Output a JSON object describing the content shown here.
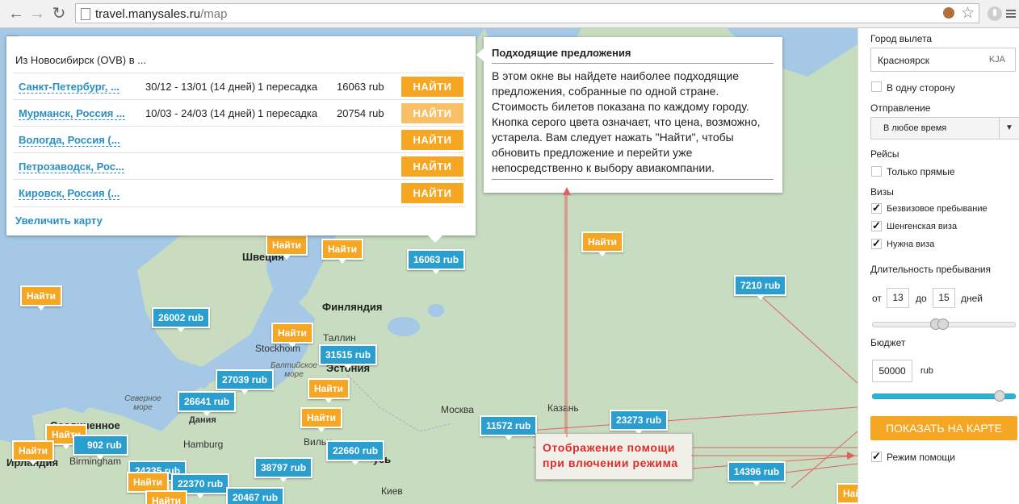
{
  "browser": {
    "url_host": "travel.manysales.ru",
    "url_path": "/map"
  },
  "map": {
    "labels": {
      "sweden": "Швеция",
      "finland": "Финляндия",
      "tallinn": "Таллин",
      "stockholm": "Stockholm",
      "baltic_sea": "Балтийское море",
      "estonia": "Эстония",
      "north_sea": "Северное море",
      "denmark": "Дания",
      "hamburg": "Hamburg",
      "birmingham": "Birmingham",
      "ireland": "Ирландия",
      "uk": "Соединенное",
      "moscow": "Москва",
      "kazan": "Казань",
      "vilnius": "Вильн",
      "kiev": "Киев",
      "russia_frag": "усь"
    },
    "pins": [
      {
        "text": "16063 rub",
        "kind": "price"
      },
      {
        "text": "Найти",
        "kind": "find"
      },
      {
        "text": "Найти",
        "kind": "find"
      },
      {
        "text": "Найти",
        "kind": "find"
      },
      {
        "text": "7210 rub",
        "kind": "price"
      },
      {
        "text": "Найти",
        "kind": "find"
      },
      {
        "text": "26002 rub",
        "kind": "price"
      },
      {
        "text": "Найти",
        "kind": "find"
      },
      {
        "text": "31515 rub",
        "kind": "price"
      },
      {
        "text": "27039 rub",
        "kind": "price"
      },
      {
        "text": "26641 rub",
        "kind": "price"
      },
      {
        "text": "Найти",
        "kind": "find"
      },
      {
        "text": "Найти",
        "kind": "find"
      },
      {
        "text": "11572 rub",
        "kind": "price"
      },
      {
        "text": "23273 rub",
        "kind": "price"
      },
      {
        "text": "22660 rub",
        "kind": "price"
      },
      {
        "text": "38797 rub",
        "kind": "price"
      },
      {
        "text": "24235 rub",
        "kind": "price"
      },
      {
        "text": "22370 rub",
        "kind": "price"
      },
      {
        "text": "20467 rub",
        "kind": "price"
      },
      {
        "text": "14396 rub",
        "kind": "price"
      },
      {
        "text": "Найти",
        "kind": "find"
      },
      {
        "text": "Найти",
        "kind": "find"
      },
      {
        "text": "Найти",
        "kind": "find"
      },
      {
        "text": "Найти",
        "kind": "find"
      },
      {
        "text": "Найти",
        "kind": "find"
      }
    ],
    "partial_pin_text": "902 rub"
  },
  "offers": {
    "header": "Из Новосибирск (OVB) в ...",
    "rows": [
      {
        "city": "Санкт-Петербург, ...",
        "dates": "30/12 - 13/01 (14 дней)",
        "stops": "1 пересадка",
        "price": "16063 rub",
        "button": "НАЙТИ"
      },
      {
        "city": "Мурманск, Россия ...",
        "dates": "10/03 - 24/03 (14 дней)",
        "stops": "1 пересадка",
        "price": "20754 rub",
        "button": "НАЙТИ"
      },
      {
        "city": "Вологда, Россия (...",
        "dates": "",
        "stops": "",
        "price": "",
        "button": "НАЙТИ"
      },
      {
        "city": "Петрозаводск, Рос...",
        "dates": "",
        "stops": "",
        "price": "",
        "button": "НАЙТИ"
      },
      {
        "city": "Кировск, Россия (...",
        "dates": "",
        "stops": "",
        "price": "",
        "button": "НАЙТИ"
      }
    ],
    "enlarge_link": "Увеличить карту"
  },
  "help": {
    "title": "Подходящие предложения",
    "body": "В этом окне вы найдете наиболее подходящие предложения, собранные по одной стране. Стоимость билетов показана по каждому городу. Кнопка серого цвета означает, что цена, возможно, устарела. Вам следует нажать \"Найти\", чтобы обновить предложение и перейти уже непосредственно к выбору авиакомпании."
  },
  "callout": {
    "line1": "Отображение помощи",
    "line2": "при влючении режима"
  },
  "sidebar": {
    "departure_label": "Город вылета",
    "departure_city": "Красноярск",
    "departure_code": "KJA",
    "one_way_label": "В одну сторону",
    "one_way_checked": false,
    "departure_time_label": "Отправление",
    "departure_time_value": "В любое время",
    "flights_label": "Рейсы",
    "direct_only_label": "Только прямые",
    "direct_only_checked": false,
    "visas_label": "Визы",
    "visas": [
      {
        "label": "Безвизовое пребывание",
        "checked": true
      },
      {
        "label": "Шенгенская виза",
        "checked": true
      },
      {
        "label": "Нужна виза",
        "checked": true
      }
    ],
    "duration_label": "Длительность пребывания",
    "from_label": "от",
    "from_value": "13",
    "to_label": "до",
    "to_value": "15",
    "days_label": "дней",
    "budget_label": "Бюджет",
    "budget_value": "50000",
    "budget_unit": "rub",
    "show_button": "ПОКАЗАТЬ НА КАРТЕ",
    "help_mode_label": "Режим помощи",
    "help_mode_checked": true
  },
  "icons": {
    "back": "back-arrow-icon",
    "forward": "forward-arrow-icon",
    "reload": "reload-icon",
    "star": "star-icon"
  },
  "colors": {
    "accent_orange": "#f5a623",
    "price_blue": "#2b9ed0",
    "link_blue": "#2a8fc4",
    "callout_red": "#e02b2b"
  }
}
